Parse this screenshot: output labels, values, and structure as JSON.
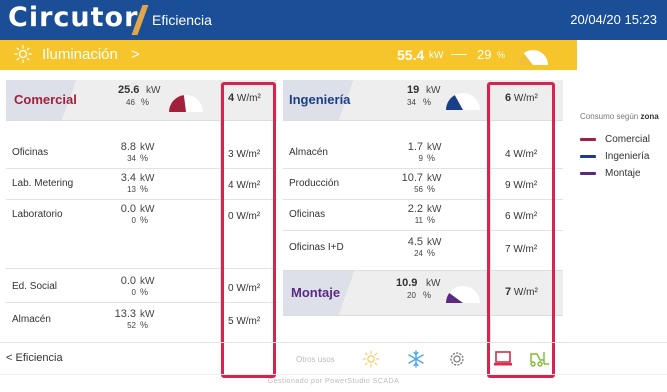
{
  "header": {
    "logo": "Circutor",
    "title": "Eficiencia",
    "datetime": "20/04/20 15:23"
  },
  "summary": {
    "icon": "sun-icon",
    "title": "Iluminación",
    "chevron": ">",
    "power": "55.4",
    "power_unit": "kW",
    "percent": "29",
    "percent_unit": "%",
    "percent_value": 29
  },
  "zones": {
    "comercial": {
      "name": "Comercial",
      "color": "#a3203c",
      "power": "25.6",
      "power_unit": "kW",
      "percent": "46",
      "percent_unit": "%",
      "percent_value": 46,
      "density": "4",
      "density_unit": "W/m²",
      "items": [
        {
          "label": "Oficinas",
          "power": "8.8",
          "power_unit": "kW",
          "percent": "34",
          "percent_unit": "%",
          "density": "3",
          "density_unit": "W/m²"
        },
        {
          "label": "Lab. Metering",
          "power": "3.4",
          "power_unit": "kW",
          "percent": "13",
          "percent_unit": "%",
          "density": "4",
          "density_unit": "W/m²"
        },
        {
          "label": "Laboratorio",
          "power": "0.0",
          "power_unit": "kW",
          "percent": "0",
          "percent_unit": "%",
          "density": "0",
          "density_unit": "W/m²"
        },
        {
          "label": "Ed. Social",
          "power": "0.0",
          "power_unit": "kW",
          "percent": "0",
          "percent_unit": "%",
          "density": "0",
          "density_unit": "W/m²"
        },
        {
          "label": "Almacén",
          "power": "13.3",
          "power_unit": "kW",
          "percent": "52",
          "percent_unit": "%",
          "density": "5",
          "density_unit": "W/m²"
        }
      ]
    },
    "ingenieria": {
      "name": "Ingeniería",
      "color": "#1b3f86",
      "power": "19",
      "power_unit": "kW",
      "percent": "34",
      "percent_unit": "%",
      "percent_value": 34,
      "density": "6",
      "density_unit": "W/m²",
      "items": [
        {
          "label": "Almacén",
          "power": "1.7",
          "power_unit": "kW",
          "percent": "9",
          "percent_unit": "%",
          "density": "4",
          "density_unit": "W/m²"
        },
        {
          "label": "Producción",
          "power": "10.7",
          "power_unit": "kW",
          "percent": "56",
          "percent_unit": "%",
          "density": "9",
          "density_unit": "W/m²"
        },
        {
          "label": "Oficinas",
          "power": "2.2",
          "power_unit": "kW",
          "percent": "11",
          "percent_unit": "%",
          "density": "6",
          "density_unit": "W/m²"
        },
        {
          "label": "Oficinas I+D",
          "power": "4.5",
          "power_unit": "kW",
          "percent": "24",
          "percent_unit": "%",
          "density": "7",
          "density_unit": "W/m²"
        }
      ]
    },
    "montaje": {
      "name": "Montaje",
      "color": "#5a2a82",
      "power": "10.9",
      "power_unit": "kW",
      "percent": "20",
      "percent_unit": "%",
      "percent_value": 20,
      "density": "7",
      "density_unit": "W/m²"
    }
  },
  "legend": {
    "title_prefix": "Consumo según",
    "title_bold": "zona",
    "items": [
      {
        "label": "Comercial",
        "color": "#a3203c"
      },
      {
        "label": "Ingeniería",
        "color": "#1b3f86"
      },
      {
        "label": "Montaje",
        "color": "#5a2a82"
      }
    ]
  },
  "bottom": {
    "back_label": "< Eficiencia",
    "other_uses": "Otros usos",
    "icons": [
      "sun-icon",
      "snowflake-icon",
      "gear-icon",
      "computer-icon",
      "forklift-icon"
    ]
  },
  "footer": {
    "text": "Gestionado por PowerStudio SCADA"
  },
  "colors": {
    "header_bg": "#1a4f97",
    "summary_bg": "#f6c52b",
    "highlight": "#d9224d",
    "accent_orange": "#e9a23b"
  }
}
